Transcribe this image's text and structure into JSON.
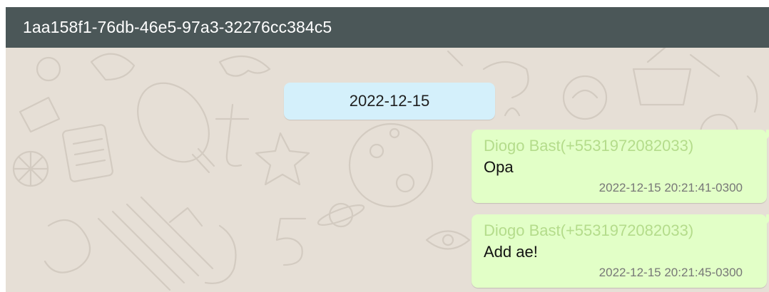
{
  "header": {
    "title": "1aa158f1-76db-46e5-97a3-32276cc384c5"
  },
  "date_separator": "2022-12-15",
  "messages": [
    {
      "sender": "Diogo Bast(+5531972082033)",
      "text": "Opa",
      "timestamp": "2022-12-15 20:21:41-0300"
    },
    {
      "sender": "Diogo Bast(+5531972082033)",
      "text": "Add ae!",
      "timestamp": "2022-12-15 20:21:45-0300"
    }
  ],
  "colors": {
    "header_bg": "#4b5758",
    "chat_bg": "#e6dfd6",
    "date_chip_bg": "#d4f0fb",
    "bubble_bg": "#e2ffc7",
    "sender_color": "#b4dc8b"
  }
}
